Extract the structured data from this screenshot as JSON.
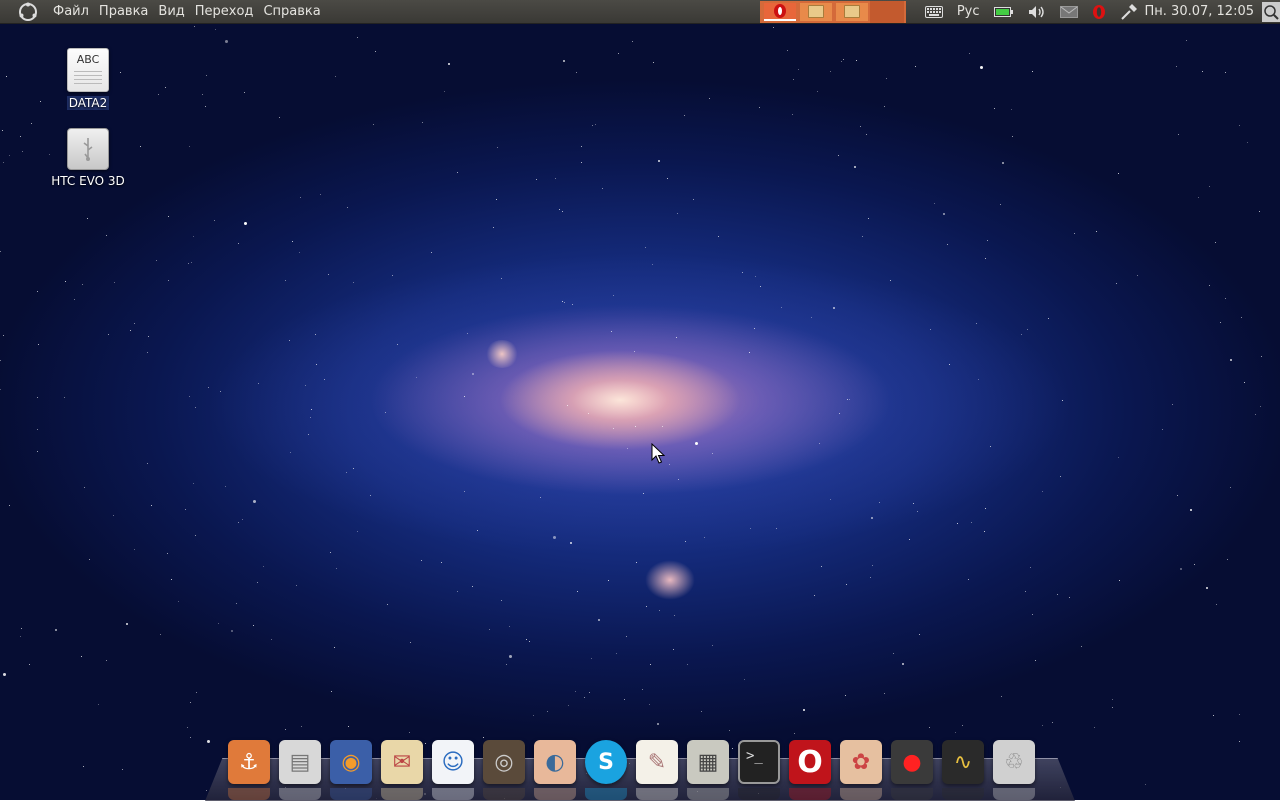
{
  "panel": {
    "menu": [
      {
        "label": "Файл"
      },
      {
        "label": "Правка"
      },
      {
        "label": "Вид"
      },
      {
        "label": "Переход"
      },
      {
        "label": "Справка"
      }
    ],
    "keyboard_layout": "Рус",
    "datetime": "Пн. 30.07, 12:05"
  },
  "desktop_icons": [
    {
      "label": "DATA2",
      "icon": "document-icon",
      "doc_text": "ABC"
    },
    {
      "label": "HTC EVO 3D",
      "icon": "usb-drive-icon"
    }
  ],
  "dock": {
    "items": [
      {
        "name": "anchor-icon",
        "color": "#e07a3a"
      },
      {
        "name": "file-cabinet-icon",
        "color": "#d8d8d8"
      },
      {
        "name": "firefox-icon",
        "color": "#3b5fa8"
      },
      {
        "name": "mail-icon",
        "color": "#e9d7a8"
      },
      {
        "name": "chat-icon",
        "color": "#f2f4f8"
      },
      {
        "name": "speaker-icon",
        "color": "#5a4a3a"
      },
      {
        "name": "eye-icon",
        "color": "#e8b89a"
      },
      {
        "name": "skype-icon",
        "color": "#1aa3e0"
      },
      {
        "name": "text-editor-icon",
        "color": "#f4f1e8"
      },
      {
        "name": "calculator-icon",
        "color": "#c9c9c0"
      },
      {
        "name": "terminal-icon",
        "color": "#222222"
      },
      {
        "name": "opera-icon",
        "color": "#c0141b"
      },
      {
        "name": "paint-icon",
        "color": "#e6c0a0"
      },
      {
        "name": "hal-red-eye-icon",
        "color": "#3a3a3a"
      },
      {
        "name": "system-monitor-icon",
        "color": "#2a2a2a"
      },
      {
        "name": "trash-icon",
        "color": "#d0d0d0"
      }
    ]
  }
}
